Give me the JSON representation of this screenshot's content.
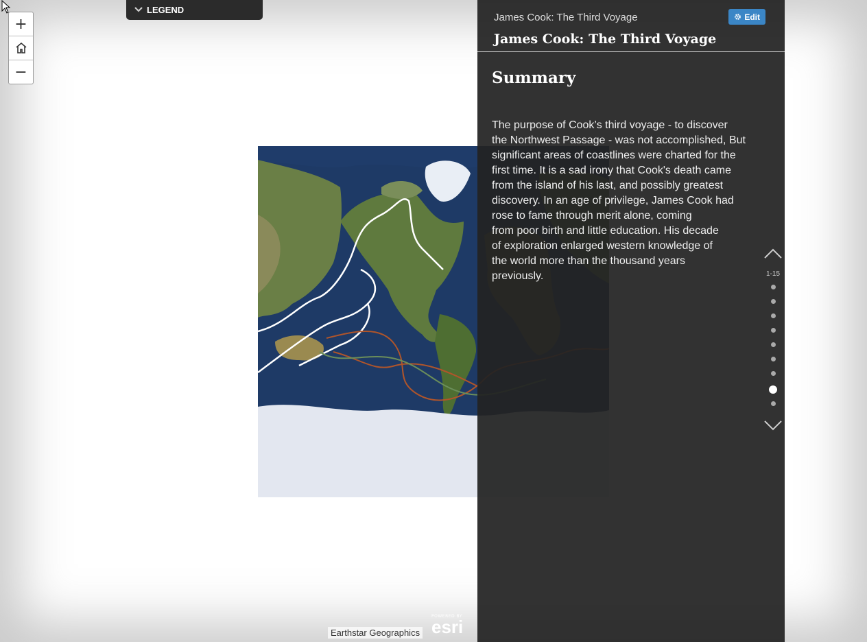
{
  "legend": {
    "label": "LEGEND"
  },
  "zoom": {
    "zoom_in": "+",
    "zoom_out": "−"
  },
  "panel": {
    "small_title": "James Cook: The Third Voyage",
    "edit_label": "Edit",
    "title": "James Cook: The Third Voyage",
    "section_heading": "Summary",
    "summary_lines": [
      "The purpose of Cook’s third voyage - to discover",
      "the Northwest Passage - was not accomplished, But",
      "significant areas of coastlines were charted for the",
      "first time. It is a sad irony that Cook's death came",
      "from the island of his last, and possibly greatest",
      "discovery. In an age of privilege, James Cook had",
      "rose to fame through merit alone, coming",
      "from poor birth and little education. His decade",
      "of exploration enlarged western knowledge of",
      "the world more than the thousand years",
      "previously."
    ]
  },
  "pager": {
    "range": "1-15",
    "dot_count": 9,
    "active_index": 7
  },
  "attribution": {
    "text": "Earthstar Geographics",
    "powered_by": "POWERED BY",
    "brand": "esri"
  },
  "colors": {
    "panel_bg": "#222222",
    "edit_button": "#3b86c6",
    "route_white": "#ffffff",
    "route_orange": "#b0552a",
    "route_green": "#6b8e5a"
  },
  "icons": [
    "home-icon",
    "chevron-down-icon",
    "gear-icon",
    "chevron-up-icon",
    "cursor-icon"
  ]
}
